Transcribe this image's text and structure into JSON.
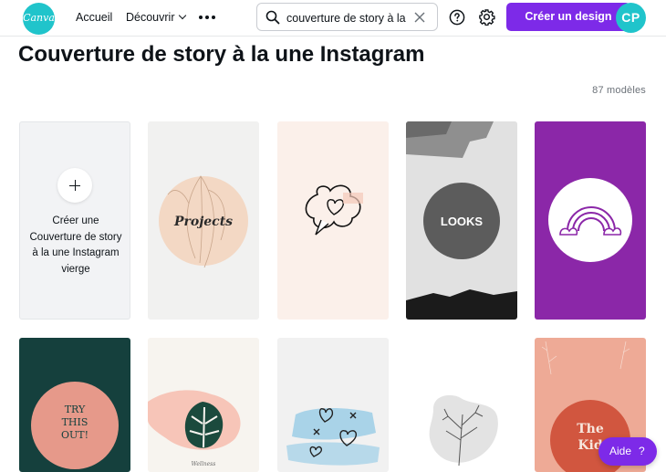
{
  "header": {
    "logo_text": "Canva",
    "nav": {
      "home": "Accueil",
      "discover": "Découvrir",
      "more_icon": "more-dots-icon"
    },
    "search": {
      "value": "couverture de story à la u",
      "icon": "search-icon",
      "clear_icon": "close-icon"
    },
    "help_icon": "question-icon",
    "settings_icon": "gear-icon",
    "create_button": "Créer un design",
    "avatar_initials": "CP",
    "colors": {
      "accent": "#7d2ae8",
      "brand": "#20c4cb"
    }
  },
  "page": {
    "title": "Couverture de story à la une Instagram",
    "count": "87 modèles"
  },
  "templates": {
    "blank": {
      "label": "Créer une Couverture de story à la une Instagram vierge",
      "icon": "plus-icon"
    },
    "items": [
      {
        "text": "Projects",
        "bg": "#f1f1f0",
        "accent": "#f3d8c4"
      },
      {
        "text": "",
        "bg": "#fbf0ea",
        "accent": "#f4c8b8",
        "icon": "cloud-heart-icon"
      },
      {
        "text": "LOOKS",
        "bg": "#d9d9d9",
        "accent": "#5c5c5c"
      },
      {
        "text": "",
        "bg": "#8b27a8",
        "accent": "#ffffff",
        "icon": "rainbow-icon"
      },
      {
        "text": "TRY THIS OUT!",
        "bg": "#15403d",
        "accent": "#e6998a"
      },
      {
        "text": "Wellness",
        "bg": "#f7f4ef",
        "accent": "#f7c5b8",
        "icon": "monstera-leaf-icon"
      },
      {
        "text": "",
        "bg": "#f1f1f1",
        "accent": "#a9d3e8",
        "icon": "hearts-icon"
      },
      {
        "text": "",
        "bg": "#ffffff",
        "accent": "#e3e3e3",
        "icon": "branch-icon"
      },
      {
        "text": "The Kid",
        "bg": "#eeaa96",
        "accent": "#d1563f"
      }
    ]
  },
  "help_button": {
    "label": "Aide",
    "icon": "?"
  }
}
